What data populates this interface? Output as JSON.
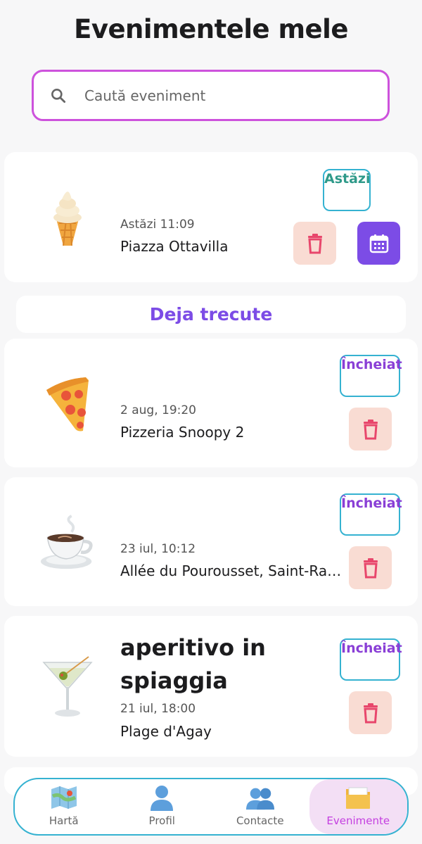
{
  "header": {
    "title": "Evenimentele mele"
  },
  "search": {
    "placeholder": "Caută eveniment"
  },
  "upcoming": [
    {
      "emoji": "ice-cream-icon",
      "when": "Astăzi 11:09",
      "place": "Piazza Ottavilla",
      "badge": "Astăzi"
    }
  ],
  "past_section": {
    "label": "Deja trecute"
  },
  "past": [
    {
      "emoji": "pizza-icon",
      "when": "2 aug, 19:20",
      "place": "Pizzeria Snoopy 2",
      "badge": "Încheiat"
    },
    {
      "emoji": "coffee-icon",
      "when": "23 iul, 10:12",
      "place": "Allée du Pourousset, Saint-Raphaël",
      "badge": "Încheiat"
    },
    {
      "emoji": "cocktail-icon",
      "title": "aperitivo in spiaggia",
      "when": "21 iul, 18:00",
      "place": "Plage d'Agay",
      "badge": "Încheiat"
    }
  ],
  "nav": [
    {
      "label": "Hartă",
      "icon": "map-icon",
      "active": false
    },
    {
      "label": "Profil",
      "icon": "person-icon",
      "active": false
    },
    {
      "label": "Contacte",
      "icon": "people-icon",
      "active": false
    },
    {
      "label": "Evenimente",
      "icon": "folder-icon",
      "active": true
    }
  ],
  "colors": {
    "accent": "#7c4ce6",
    "search_border": "#cd52dc",
    "badge_border": "#35b2d1",
    "delete_bg": "#f9dcd3",
    "nav_active": "#c43fe0"
  }
}
